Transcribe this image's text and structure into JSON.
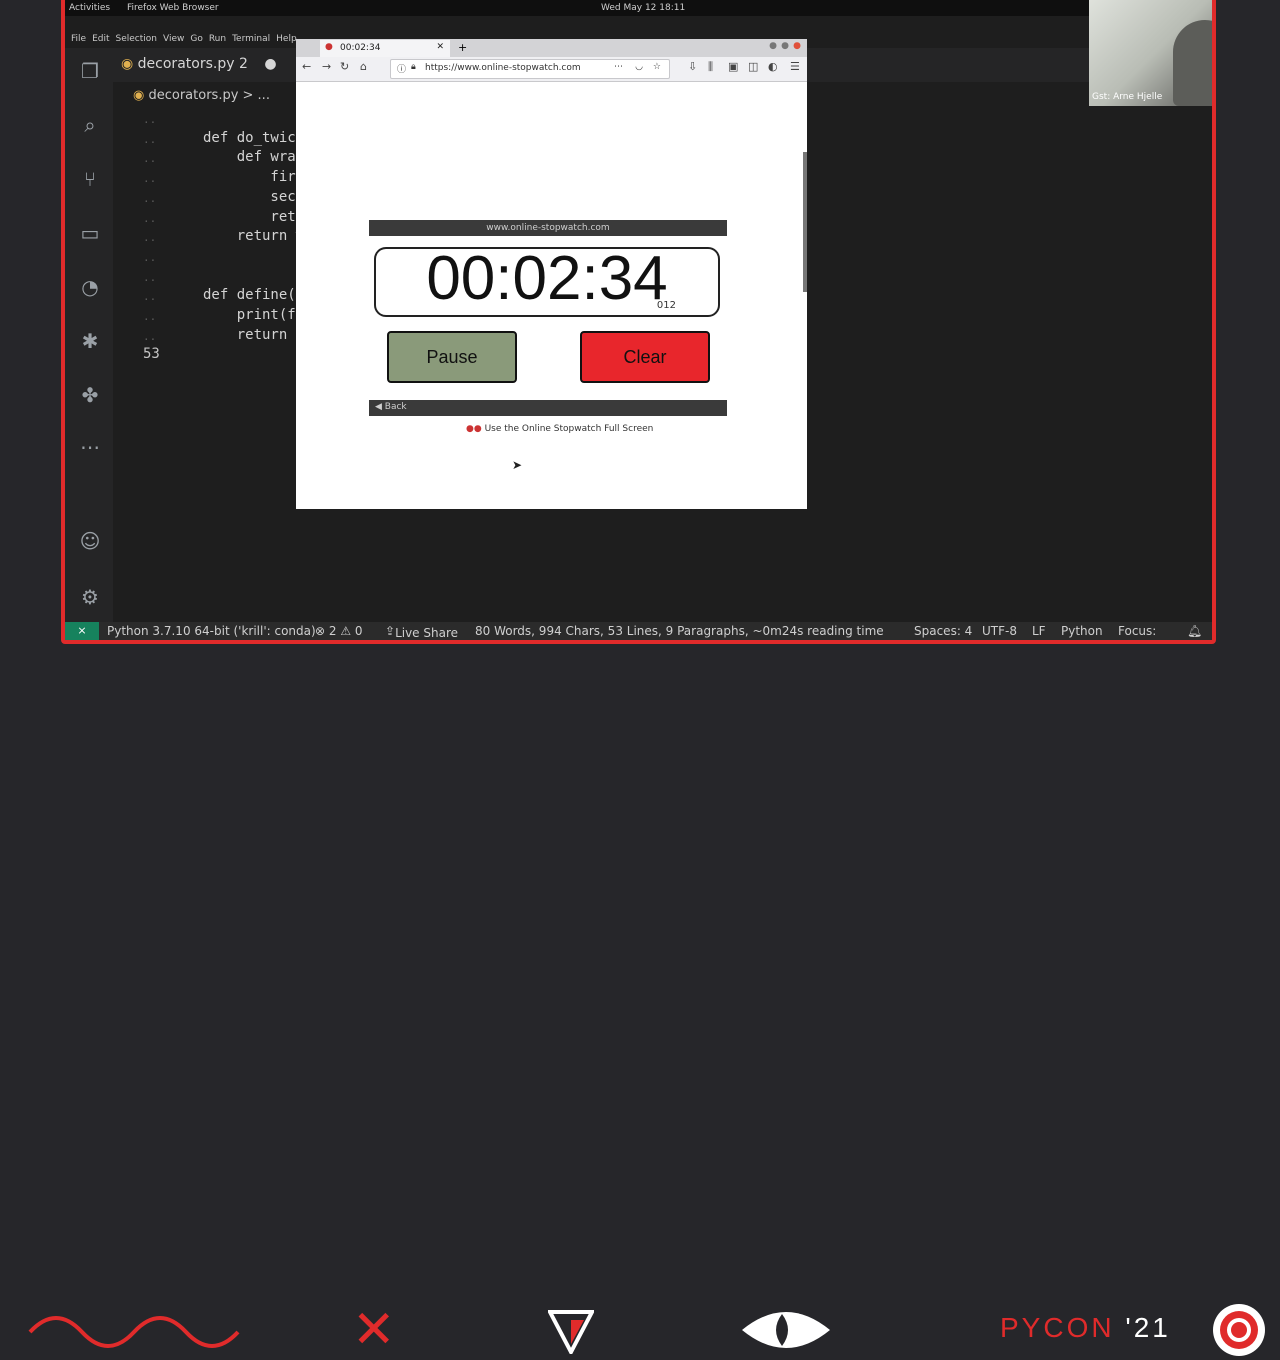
{
  "system": {
    "activities": "Activities",
    "browser_app": "Firefox Web Browser",
    "clock": "Wed May 12 18:11"
  },
  "vscode": {
    "menu": [
      "File",
      "Edit",
      "Selection",
      "View",
      "Go",
      "Run",
      "Terminal",
      "Help"
    ],
    "tab": {
      "label": "decorators.py 2"
    },
    "breadcrumb": "decorators.py > ...",
    "code_lines": [
      {
        "ln": "..",
        "text": ""
      },
      {
        "ln": "..",
        "text": "def do_twice"
      },
      {
        "ln": "..",
        "text": "    def wrap"
      },
      {
        "ln": "..",
        "text": "        firs"
      },
      {
        "ln": "..",
        "text": "        seco"
      },
      {
        "ln": "..",
        "text": "        retu"
      },
      {
        "ln": "..",
        "text": "    return w"
      },
      {
        "ln": "..",
        "text": ""
      },
      {
        "ln": "..",
        "text": ""
      },
      {
        "ln": "..",
        "text": "def define(f"
      },
      {
        "ln": "..",
        "text": "    print(f\""
      },
      {
        "ln": "..",
        "text": "    return f"
      },
      {
        "ln": "53",
        "text": ""
      }
    ],
    "status": {
      "python": "Python 3.7.10 64-bit ('krill': conda)",
      "problems": "⊗ 2 ⚠ 0",
      "liveshare": "Live Share",
      "stats": "80 Words, 994 Chars, 53 Lines, 9 Paragraphs, ~0m24s reading time",
      "spaces": "Spaces: 4",
      "encoding": "UTF-8",
      "eol": "LF",
      "language": "Python",
      "focus": "Focus:"
    }
  },
  "firefox": {
    "tab_title": "00:02:34",
    "url": "https://www.online-stopwatch.com"
  },
  "stopwatch": {
    "banner": "www.online-stopwatch.com",
    "time": "00:02:34",
    "ms": "012",
    "pause_label": "Pause",
    "clear_label": "Clear",
    "back_label": "Back",
    "fullscreen_link": "Use the Online Stopwatch Full Screen",
    "colors": {
      "pause": "#8a9a7a",
      "clear": "#e8262c"
    }
  },
  "webcam": {
    "label": "Gst: Arne Hjelle"
  },
  "footer": {
    "brand": "PYCON",
    "year": "'21",
    "accent": "#e02b2b"
  }
}
